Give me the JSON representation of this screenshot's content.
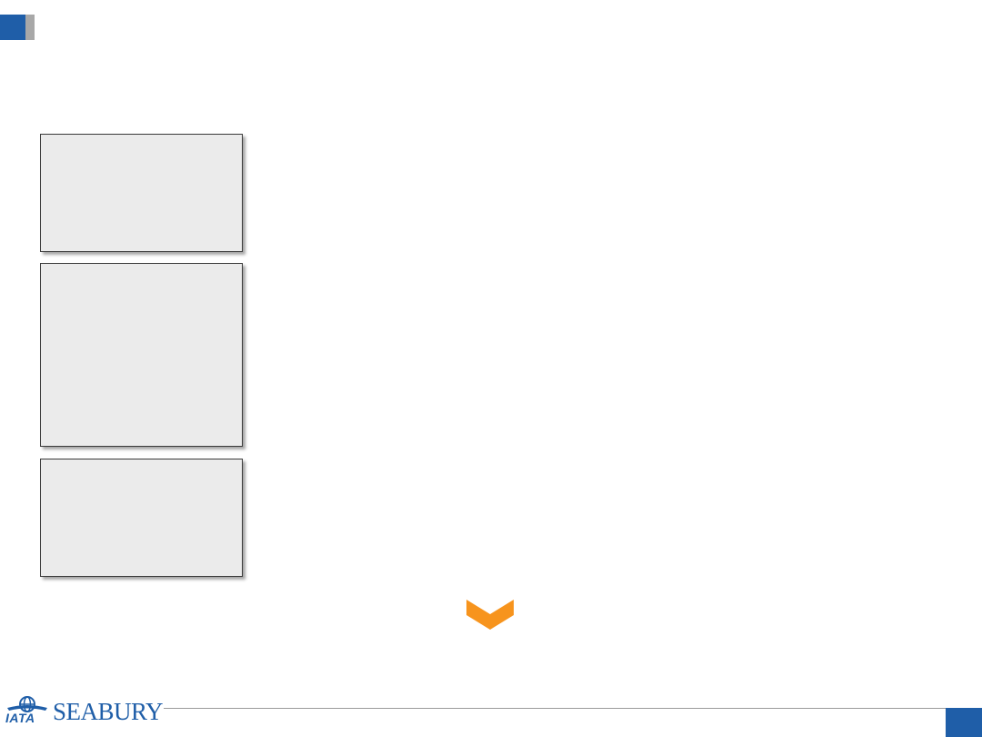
{
  "slide": {
    "colors": {
      "brand_blue": "#1f5ea8",
      "accent_orange": "#f7941d",
      "panel_fill": "#ebebeb",
      "marker_gray": "#a8a8a8"
    },
    "panels": [
      {
        "text": ""
      },
      {
        "text": ""
      },
      {
        "text": ""
      }
    ],
    "arrow_icon": "chevron-down-icon",
    "footer": {
      "logo_wordmark": "SEABURY",
      "logo_iata": "IATA",
      "page_number": ""
    }
  }
}
